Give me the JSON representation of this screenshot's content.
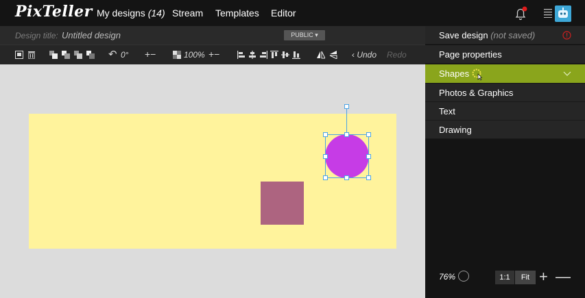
{
  "header": {
    "logo": "PixTeller",
    "nav": {
      "my_designs": "My designs",
      "my_designs_count": "(14)",
      "stream": "Stream",
      "templates": "Templates",
      "editor": "Editor"
    }
  },
  "titlebar": {
    "label": "Design title:",
    "value": "Untitled design",
    "public": "PUBLIC"
  },
  "toolbar": {
    "rotation": "0°",
    "opacity": "100%",
    "undo": "Undo",
    "redo": "Redo"
  },
  "panel": {
    "save": "Save design",
    "save_status": "(not saved)",
    "page_properties": "Page properties",
    "shapes": "Shapes",
    "photos": "Photos & Graphics",
    "text": "Text",
    "drawing": "Drawing",
    "accent_color": "#8aa51c"
  },
  "zoom": {
    "value": "76%",
    "one_to_one": "1:1",
    "fit": "Fit"
  },
  "canvas": {
    "artboard_color": "#fff39c",
    "square_color": "#ad6480",
    "circle_color": "#c63ce6"
  }
}
